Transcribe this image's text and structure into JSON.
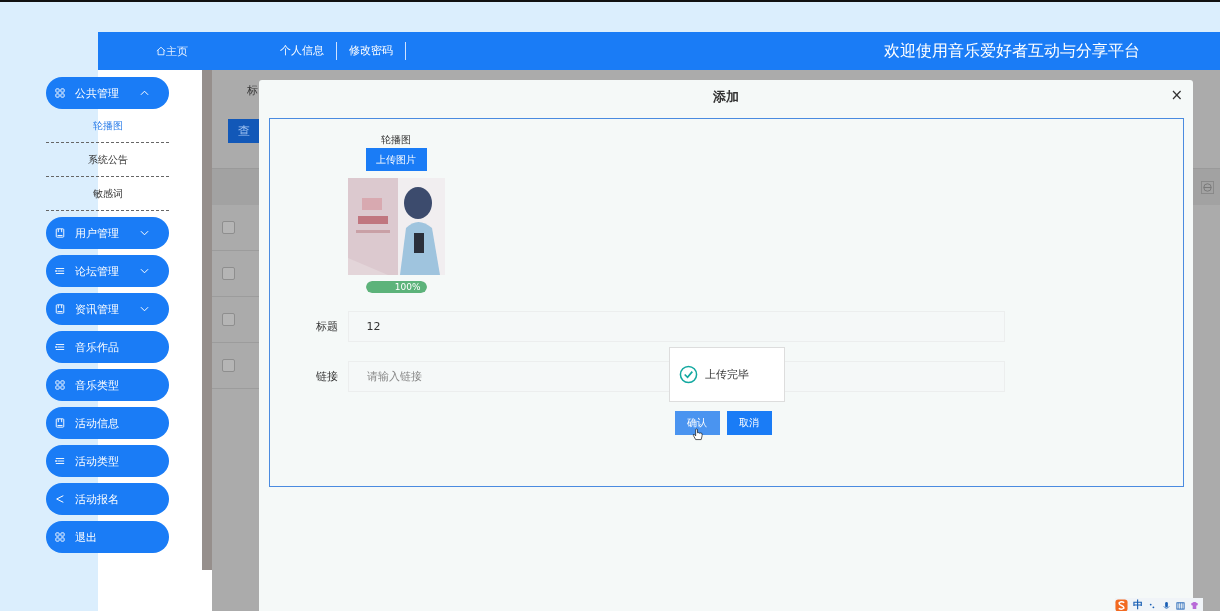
{
  "header": {
    "home": "主页",
    "links": [
      "个人信息",
      "修改密码"
    ],
    "title": "欢迎使用音乐爱好者互动与分享平台"
  },
  "sidebar": {
    "items": [
      {
        "kind": "grid",
        "label": "公共管理",
        "expanded": true,
        "children": [
          {
            "label": "轮播图",
            "selected": true
          },
          {
            "label": "系统公告",
            "selected": false
          },
          {
            "label": "敏感词",
            "selected": false
          }
        ]
      },
      {
        "kind": "book",
        "label": "用户管理",
        "expanded": false
      },
      {
        "kind": "list",
        "label": "论坛管理",
        "expanded": false
      },
      {
        "kind": "book",
        "label": "资讯管理",
        "expanded": false
      },
      {
        "kind": "list",
        "label": "音乐作品"
      },
      {
        "kind": "grid",
        "label": "音乐类型"
      },
      {
        "kind": "book",
        "label": "活动信息"
      },
      {
        "kind": "list",
        "label": "活动类型"
      },
      {
        "kind": "share",
        "label": "活动报名"
      },
      {
        "kind": "grid",
        "label": "退出"
      }
    ]
  },
  "page": {
    "search_label": "标",
    "search_button": "查",
    "rows": [
      {
        "checked": false
      },
      {
        "checked": false
      },
      {
        "checked": false
      },
      {
        "checked": false
      }
    ]
  },
  "modal": {
    "title": "添加",
    "close": "×",
    "upload": {
      "label": "轮播图",
      "button": "上传图片",
      "progress": {
        "level": 1,
        "text": "100%"
      }
    },
    "fields": [
      {
        "label": "标题",
        "value": "12"
      },
      {
        "label": "链接",
        "placeholder": "请输入链接"
      }
    ],
    "buttons": [
      {
        "label": "确认",
        "hovered": true
      },
      {
        "label": "取消",
        "hovered": false
      }
    ]
  },
  "toast": {
    "text": "上传完毕"
  },
  "ime": {
    "text": "中"
  }
}
